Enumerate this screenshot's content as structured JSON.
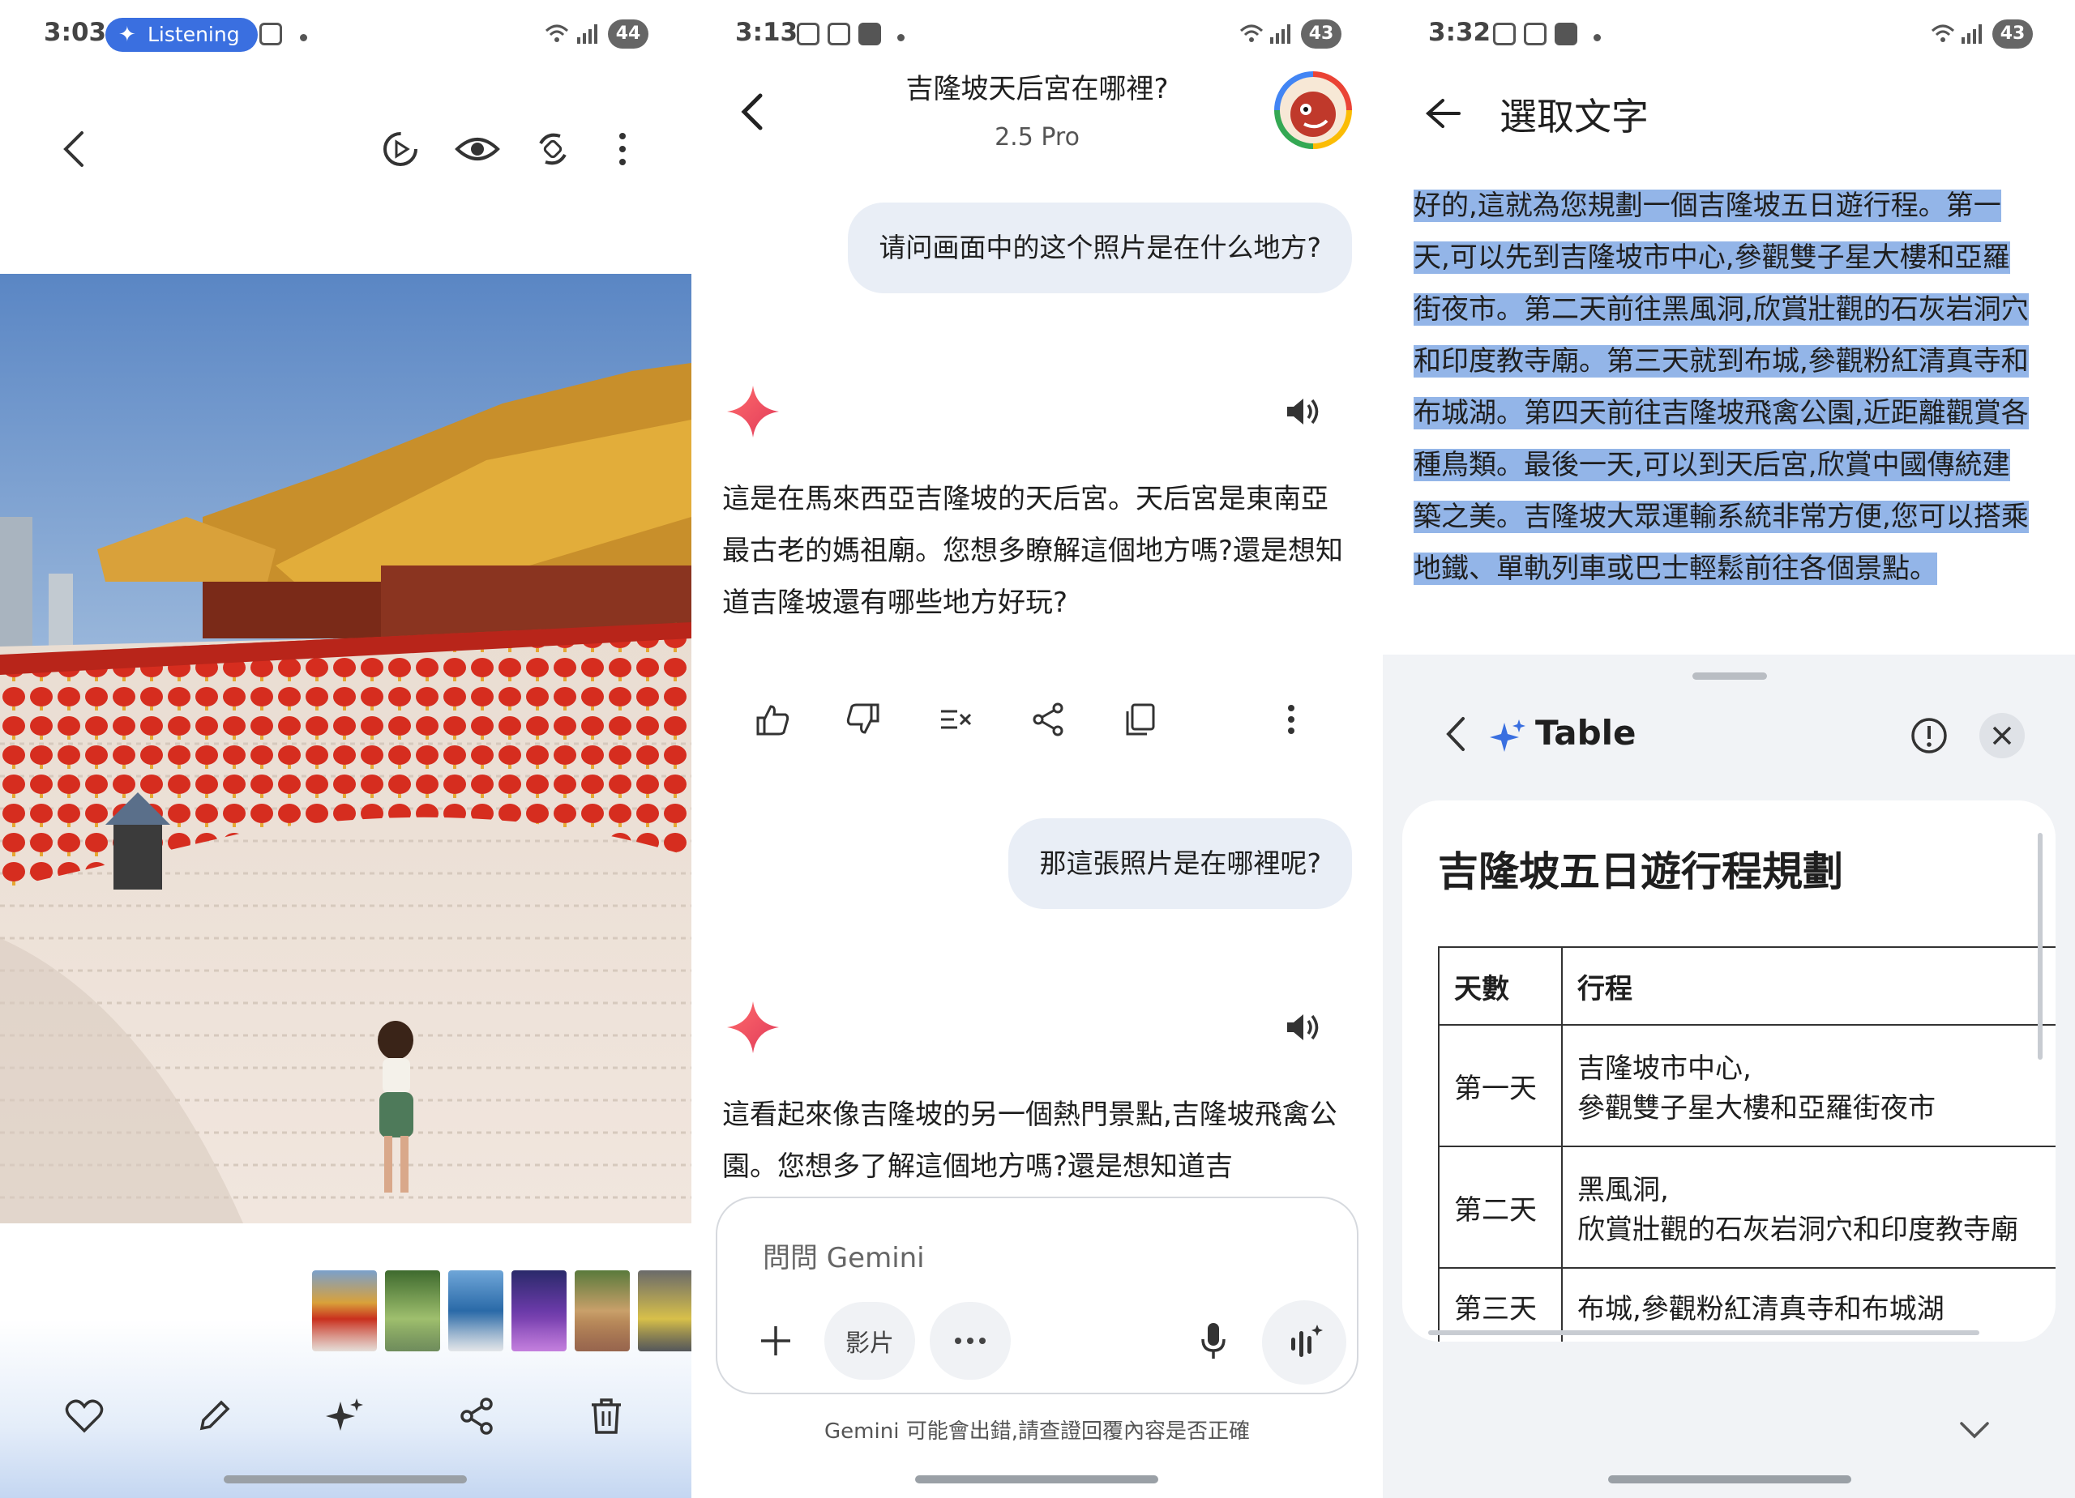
{
  "panel1": {
    "status": {
      "time": "3:03",
      "listening_label": "Listening",
      "battery": "44"
    },
    "thumbnails": [
      "temple",
      "park",
      "city",
      "night",
      "street",
      "market"
    ],
    "bottom_actions": [
      "heart-icon",
      "pencil-icon",
      "sparkle-icon",
      "share-icon",
      "trash-icon"
    ]
  },
  "panel2": {
    "status": {
      "time": "3:13",
      "battery": "43"
    },
    "header": {
      "title": "吉隆坡天后宮在哪裡?",
      "subtitle": "2.5 Pro"
    },
    "messages": [
      {
        "role": "user",
        "text": "请问画面中的这个照片是在什么地方?"
      },
      {
        "role": "assistant",
        "text": "這是在馬來西亞吉隆坡的天后宮。天后宮是東南亞最古老的媽祖廟。您想多瞭解這個地方嗎?還是想知道吉隆坡還有哪些地方好玩?"
      },
      {
        "role": "user",
        "text": "那這張照片是在哪裡呢?"
      },
      {
        "role": "assistant",
        "text": "這看起來像吉隆坡的另一個熱門景點,吉隆坡飛禽公園。您想多了解這個地方嗎?還是想知道吉"
      }
    ],
    "input": {
      "placeholder": "問問 Gemini",
      "chip_video": "影片"
    },
    "disclaimer": "Gemini 可能會出錯,請查證回覆內容是否正確"
  },
  "panel3": {
    "status": {
      "time": "3:32",
      "battery": "43"
    },
    "title": "選取文字",
    "selected_text": "好的,這就為您規劃一個吉隆坡五日遊行程。第一天,可以先到吉隆坡市中心,參觀雙子星大樓和亞羅街夜市。第二天前往黑風洞,欣賞壯觀的石灰岩洞穴和印度教寺廟。第三天就到布城,參觀粉紅清真寺和布城湖。第四天前往吉隆坡飛禽公園,近距離觀賞各種鳥類。最後一天,可以到天后宮,欣賞中國傳統建築之美。吉隆坡大眾運輸系統非常方便,您可以搭乘地鐵、單軌列車或巴士輕鬆前往各個景點。",
    "sheet": {
      "title": "Table",
      "card_title": "吉隆坡五日遊行程規劃",
      "columns": [
        "天數",
        "行程"
      ],
      "rows": [
        {
          "day": "第一天",
          "line1": "吉隆坡市中心,",
          "line2": "參觀雙子星大樓和亞羅街夜市"
        },
        {
          "day": "第二天",
          "line1": "黑風洞,",
          "line2": "欣賞壯觀的石灰岩洞穴和印度教寺廟"
        },
        {
          "day": "第三天",
          "line1": "布城,參觀粉紅清真寺和布城湖",
          "line2": ""
        }
      ]
    }
  }
}
